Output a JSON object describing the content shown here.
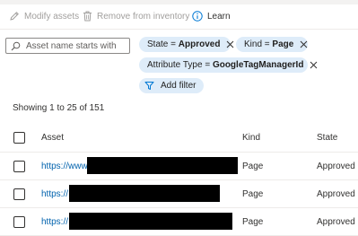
{
  "toolbar": {
    "modify_label": "Modify assets",
    "remove_label": "Remove from inventory",
    "learn_label": "Learn"
  },
  "search": {
    "placeholder": "Asset name starts with",
    "value": ""
  },
  "filters": [
    {
      "key": "State",
      "op": "=",
      "value": "Approved"
    },
    {
      "key": "Kind",
      "op": "=",
      "value": "Page"
    },
    {
      "key": "Attribute Type",
      "op": "=",
      "value": "GoogleTagManagerId"
    }
  ],
  "add_filter_label": "Add filter",
  "showing_text": "Showing 1 to 25 of 151",
  "table": {
    "columns": [
      "Asset",
      "Kind",
      "State"
    ],
    "rows": [
      {
        "asset": "https://www.",
        "kind": "Page",
        "state": "Approved"
      },
      {
        "asset": "https://",
        "kind": "Page",
        "state": "Approved"
      },
      {
        "asset": "https://",
        "kind": "Page",
        "state": "Approved"
      }
    ]
  },
  "colors": {
    "accent": "#0078d4",
    "link": "#0062ad",
    "pill_bg": "#deecf9",
    "disabled_text": "#a19f9d",
    "redaction": "#000000"
  },
  "icons": {
    "modify": "pencil-icon",
    "remove": "trash-icon",
    "learn": "info-icon",
    "search": "search-icon",
    "pill_remove": "close-icon",
    "add_filter": "funnel-icon"
  }
}
